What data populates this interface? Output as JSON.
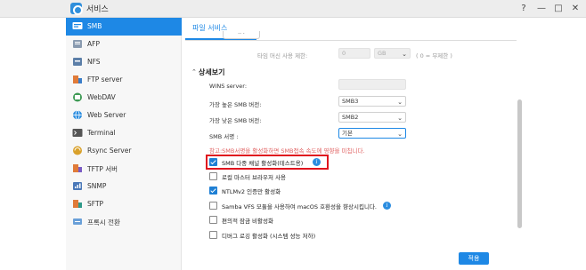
{
  "window": {
    "title": "서비스",
    "help": "?",
    "minimize": "—",
    "maximize": "□",
    "close": "✕"
  },
  "sidebar": {
    "items": [
      {
        "label": "SMB",
        "icon": "smb-icon",
        "active": true
      },
      {
        "label": "AFP",
        "icon": "afp-icon"
      },
      {
        "label": "NFS",
        "icon": "nfs-icon"
      },
      {
        "label": "FTP server",
        "icon": "ftp-icon"
      },
      {
        "label": "WebDAV",
        "icon": "webdav-icon"
      },
      {
        "label": "Web Server",
        "icon": "web-server-icon"
      },
      {
        "label": "Terminal",
        "icon": "terminal-icon"
      },
      {
        "label": "Rsync Server",
        "icon": "rsync-icon"
      },
      {
        "label": "TFTP 서버",
        "icon": "tftp-icon"
      },
      {
        "label": "SNMP",
        "icon": "snmp-icon"
      },
      {
        "label": "SFTP",
        "icon": "sftp-icon"
      },
      {
        "label": "프록시 전환",
        "icon": "proxy-icon"
      }
    ]
  },
  "main": {
    "tab": "파일 서비스",
    "timemachine": {
      "label": "타임 머신 사용 제한:",
      "value": "0",
      "unit": "GB",
      "hint": "( 0 = 무제한 )"
    },
    "advanced": {
      "title": "상세보기",
      "wins_label": "WINS server:",
      "max_smb_label": "가장 높은 SMB 버전:",
      "max_smb_value": "SMB3",
      "min_smb_label": "가장 낮은 SMB 버전:",
      "min_smb_value": "SMB2",
      "signing_label": "SMB 서명 :",
      "signing_value": "기본",
      "warning": "참고:SMB서명을 활성화하면 SMB접속 속도에 영향을 미칩니다."
    },
    "options": [
      {
        "label": "SMB 다중 채널 활성화(테스트용)",
        "checked": true,
        "info": true
      },
      {
        "label": "로컬 마스터 브라우저 사용",
        "checked": false
      },
      {
        "label": "NTLMv2 인증만 활성화",
        "checked": true
      },
      {
        "label": "Samba VFS 모듈을 사용하여 macOS 호환성을 향상시킵니다.",
        "checked": false,
        "info": true
      },
      {
        "label": "편의적 잠금 비활성화",
        "checked": false
      },
      {
        "label": "디버그 로깅 활성화 (시스템 성능 저하)",
        "checked": false
      }
    ],
    "apply": "적용"
  },
  "colors": {
    "accent": "#1e88e5",
    "warning": "#e06060",
    "highlight": "#e0141e",
    "sidebar_bg": "#f7f7f7"
  }
}
